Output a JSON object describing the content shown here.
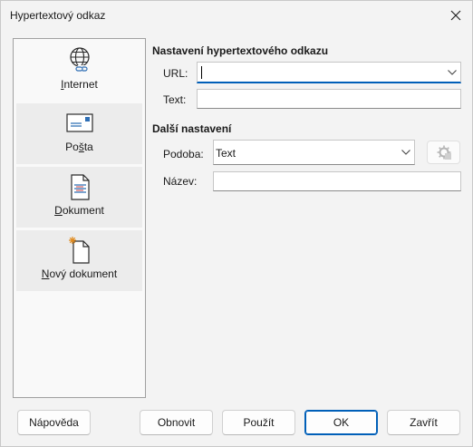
{
  "window": {
    "title": "Hypertextový odkaz"
  },
  "sidebar": {
    "items": [
      {
        "label": "Internet",
        "icon": "globe-icon",
        "active": true
      },
      {
        "label": "Pošta",
        "icon": "envelope-icon",
        "active": false
      },
      {
        "label": "Dokument",
        "icon": "document-icon",
        "active": false
      },
      {
        "label": "Nový dokument",
        "icon": "new-document-icon",
        "active": false
      }
    ]
  },
  "hyperlink_settings": {
    "heading": "Nastavení hypertextového odkazu",
    "url_label": "URL:",
    "url_value": "",
    "text_label": "Text:",
    "text_value": ""
  },
  "further_settings": {
    "heading": "Další nastavení",
    "form_label": "Podoba:",
    "form_value": "Text",
    "name_label": "Název:",
    "name_value": ""
  },
  "buttons": {
    "help": "Nápověda",
    "reset": "Obnovit",
    "apply": "Použít",
    "ok": "OK",
    "close": "Zavřít"
  },
  "colors": {
    "accent": "#005fb8"
  }
}
